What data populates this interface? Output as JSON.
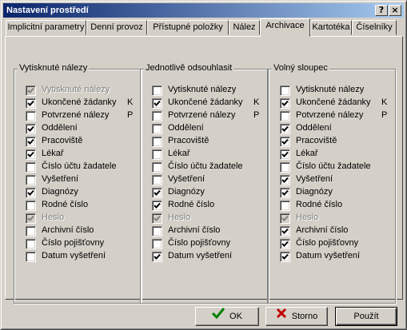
{
  "window": {
    "title": "Nastavení prostředí"
  },
  "titlebar_buttons": {
    "help": "?",
    "close": "×"
  },
  "tabs": [
    {
      "label": "Implicitní parametry",
      "active": false
    },
    {
      "label": "Denní provoz",
      "active": false
    },
    {
      "label": "Přístupné položky",
      "active": false
    },
    {
      "label": "Nález",
      "active": false
    },
    {
      "label": "Archivace",
      "active": true
    },
    {
      "label": "Kartotéka",
      "active": false
    },
    {
      "label": "Číselníky",
      "active": false
    }
  ],
  "groups": [
    {
      "title": "Vytisknuté nálezy",
      "items": [
        {
          "label": "Vytisknuté nálezy",
          "checked": true,
          "disabled": true,
          "suffix": ""
        },
        {
          "label": "Ukončené žádanky",
          "checked": true,
          "disabled": false,
          "suffix": "K"
        },
        {
          "label": "Potvrzené nálezy",
          "checked": false,
          "disabled": false,
          "suffix": "P"
        },
        {
          "label": "Oddělení",
          "checked": true,
          "disabled": false,
          "suffix": ""
        },
        {
          "label": "Pracoviště",
          "checked": true,
          "disabled": false,
          "suffix": ""
        },
        {
          "label": "Lékař",
          "checked": true,
          "disabled": false,
          "suffix": ""
        },
        {
          "label": "Číslo účtu žadatele",
          "checked": false,
          "disabled": false,
          "suffix": ""
        },
        {
          "label": "Vyšetření",
          "checked": false,
          "disabled": false,
          "suffix": ""
        },
        {
          "label": "Diagnózy",
          "checked": true,
          "disabled": false,
          "suffix": ""
        },
        {
          "label": "Rodné číslo",
          "checked": false,
          "disabled": false,
          "suffix": ""
        },
        {
          "label": "Heslo",
          "checked": true,
          "disabled": true,
          "suffix": ""
        },
        {
          "label": "Archivní číslo",
          "checked": false,
          "disabled": false,
          "suffix": ""
        },
        {
          "label": "Číslo pojišťovny",
          "checked": false,
          "disabled": false,
          "suffix": ""
        },
        {
          "label": "Datum vyšetření",
          "checked": false,
          "disabled": false,
          "suffix": ""
        }
      ]
    },
    {
      "title": "Jednotlivě odsouhlasit",
      "items": [
        {
          "label": "Vytisknuté nálezy",
          "checked": false,
          "disabled": false,
          "suffix": ""
        },
        {
          "label": "Ukončené žádanky",
          "checked": true,
          "disabled": false,
          "suffix": "K"
        },
        {
          "label": "Potvrzené nálezy",
          "checked": false,
          "disabled": false,
          "suffix": "P"
        },
        {
          "label": "Oddělení",
          "checked": false,
          "disabled": false,
          "suffix": ""
        },
        {
          "label": "Pracoviště",
          "checked": false,
          "disabled": false,
          "suffix": ""
        },
        {
          "label": "Lékař",
          "checked": false,
          "disabled": false,
          "suffix": ""
        },
        {
          "label": "Číslo účtu žadatele",
          "checked": false,
          "disabled": false,
          "suffix": ""
        },
        {
          "label": "Vyšetření",
          "checked": false,
          "disabled": false,
          "suffix": ""
        },
        {
          "label": "Diagnózy",
          "checked": true,
          "disabled": false,
          "suffix": ""
        },
        {
          "label": "Rodné číslo",
          "checked": true,
          "disabled": false,
          "suffix": ""
        },
        {
          "label": "Heslo",
          "checked": true,
          "disabled": true,
          "suffix": ""
        },
        {
          "label": "Archivní číslo",
          "checked": false,
          "disabled": false,
          "suffix": ""
        },
        {
          "label": "Číslo pojišťovny",
          "checked": false,
          "disabled": false,
          "suffix": ""
        },
        {
          "label": "Datum vyšetření",
          "checked": true,
          "disabled": false,
          "suffix": ""
        }
      ]
    },
    {
      "title": "Volný sloupec",
      "items": [
        {
          "label": "Vytisknuté nálezy",
          "checked": false,
          "disabled": false,
          "suffix": ""
        },
        {
          "label": "Ukončené žádanky",
          "checked": true,
          "disabled": false,
          "suffix": "K"
        },
        {
          "label": "Potvrzené nálezy",
          "checked": false,
          "disabled": false,
          "suffix": "P"
        },
        {
          "label": "Oddělení",
          "checked": true,
          "disabled": false,
          "suffix": ""
        },
        {
          "label": "Pracoviště",
          "checked": true,
          "disabled": false,
          "suffix": ""
        },
        {
          "label": "Lékař",
          "checked": true,
          "disabled": false,
          "suffix": ""
        },
        {
          "label": "Číslo účtu žadatele",
          "checked": false,
          "disabled": false,
          "suffix": ""
        },
        {
          "label": "Vyšetření",
          "checked": true,
          "disabled": false,
          "suffix": ""
        },
        {
          "label": "Diagnózy",
          "checked": true,
          "disabled": false,
          "suffix": ""
        },
        {
          "label": "Rodné číslo",
          "checked": false,
          "disabled": false,
          "suffix": ""
        },
        {
          "label": "Heslo",
          "checked": true,
          "disabled": true,
          "suffix": ""
        },
        {
          "label": "Archivní číslo",
          "checked": true,
          "disabled": false,
          "suffix": ""
        },
        {
          "label": "Číslo pojišťovny",
          "checked": true,
          "disabled": false,
          "suffix": ""
        },
        {
          "label": "Datum vyšetření",
          "checked": true,
          "disabled": false,
          "suffix": ""
        }
      ]
    }
  ],
  "buttons": {
    "ok": {
      "label": "OK",
      "icon": "checkmark-icon",
      "color": "#008000"
    },
    "cancel": {
      "label": "Storno",
      "icon": "x-icon",
      "color": "#c00000"
    },
    "apply": {
      "label": "Použít"
    }
  }
}
